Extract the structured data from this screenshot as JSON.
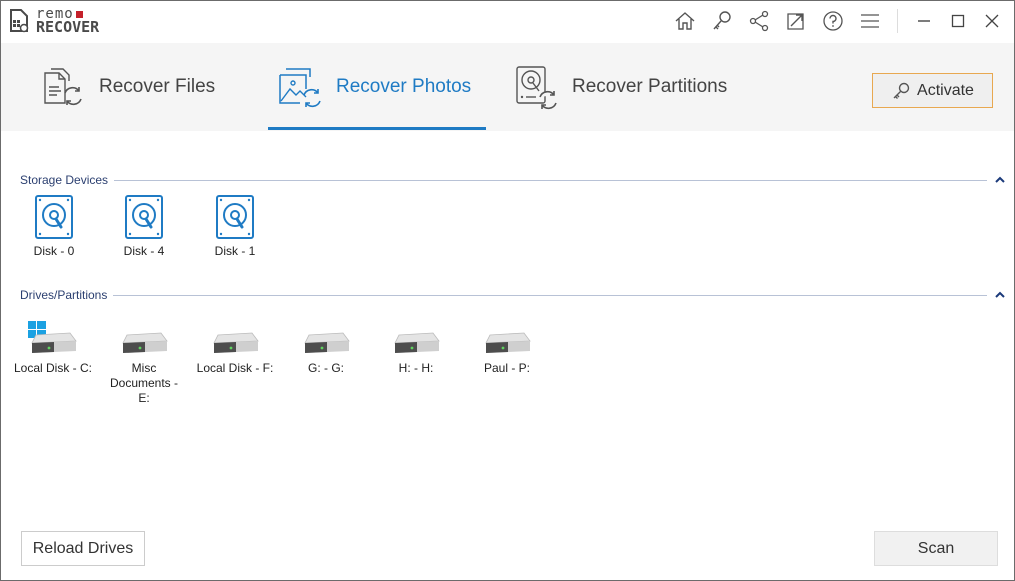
{
  "app": {
    "logo_top": "remo",
    "logo_bottom": "RECOVER",
    "brand_accent": "#c4202a"
  },
  "titlebar": {
    "icons": [
      "home-icon",
      "key-icon",
      "share-icon",
      "export-icon",
      "help-icon",
      "menu-icon"
    ],
    "window_controls": [
      "minimize-icon",
      "maximize-icon",
      "close-icon"
    ]
  },
  "tabs": [
    {
      "label": "Recover Files",
      "icon": "recover-files-icon",
      "active": false
    },
    {
      "label": "Recover Photos",
      "icon": "recover-photos-icon",
      "active": true
    },
    {
      "label": "Recover Partitions",
      "icon": "recover-partitions-icon",
      "active": false
    }
  ],
  "activate": {
    "label": "Activate",
    "icon": "key-icon"
  },
  "colors": {
    "accent": "#1f7bc4",
    "activate_border": "#e8a850",
    "section_title": "#2b3f70"
  },
  "storage_devices": {
    "title": "Storage Devices",
    "items": [
      {
        "label": "Disk - 0"
      },
      {
        "label": "Disk - 4"
      },
      {
        "label": "Disk - 1"
      }
    ]
  },
  "drives": {
    "title": "Drives/Partitions",
    "items": [
      {
        "label": "Local Disk - C:",
        "system": true
      },
      {
        "label": "Misc Documents - E:",
        "system": false
      },
      {
        "label": "Local Disk - F:",
        "system": false
      },
      {
        "label": "G: - G:",
        "system": false
      },
      {
        "label": "H: - H:",
        "system": false
      },
      {
        "label": "Paul - P:",
        "system": false
      }
    ]
  },
  "footer": {
    "reload_label": "Reload Drives",
    "scan_label": "Scan"
  }
}
